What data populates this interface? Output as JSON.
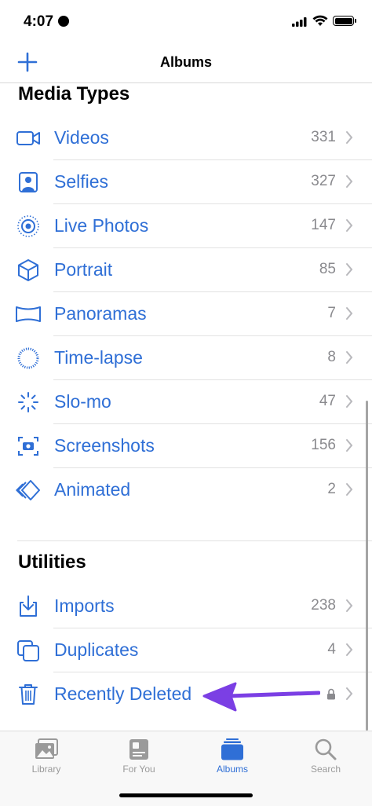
{
  "status_bar": {
    "time": "4:07"
  },
  "nav": {
    "title": "Albums"
  },
  "media_types": {
    "header": "Media Types",
    "items": [
      {
        "label": "Videos",
        "count": "331",
        "icon": "video-icon"
      },
      {
        "label": "Selfies",
        "count": "327",
        "icon": "selfie-icon"
      },
      {
        "label": "Live Photos",
        "count": "147",
        "icon": "live-photo-icon"
      },
      {
        "label": "Portrait",
        "count": "85",
        "icon": "cube-icon"
      },
      {
        "label": "Panoramas",
        "count": "7",
        "icon": "panorama-icon"
      },
      {
        "label": "Time-lapse",
        "count": "8",
        "icon": "timelapse-icon"
      },
      {
        "label": "Slo-mo",
        "count": "47",
        "icon": "slomo-icon"
      },
      {
        "label": "Screenshots",
        "count": "156",
        "icon": "screenshot-icon"
      },
      {
        "label": "Animated",
        "count": "2",
        "icon": "animated-icon"
      }
    ]
  },
  "utilities": {
    "header": "Utilities",
    "items": [
      {
        "label": "Imports",
        "count": "238",
        "icon": "import-icon"
      },
      {
        "label": "Duplicates",
        "count": "4",
        "icon": "duplicate-icon"
      },
      {
        "label": "Recently Deleted",
        "count": "",
        "icon": "trash-icon",
        "locked": true
      }
    ]
  },
  "tabs": [
    {
      "label": "Library",
      "icon": "photo-library-icon"
    },
    {
      "label": "For You",
      "icon": "for-you-icon"
    },
    {
      "label": "Albums",
      "icon": "albums-icon",
      "active": true
    },
    {
      "label": "Search",
      "icon": "search-icon"
    }
  ],
  "colors": {
    "accent": "#2f6fd6",
    "annotation_arrow": "#7b3fe4",
    "secondary_text": "#8a8a8e"
  }
}
